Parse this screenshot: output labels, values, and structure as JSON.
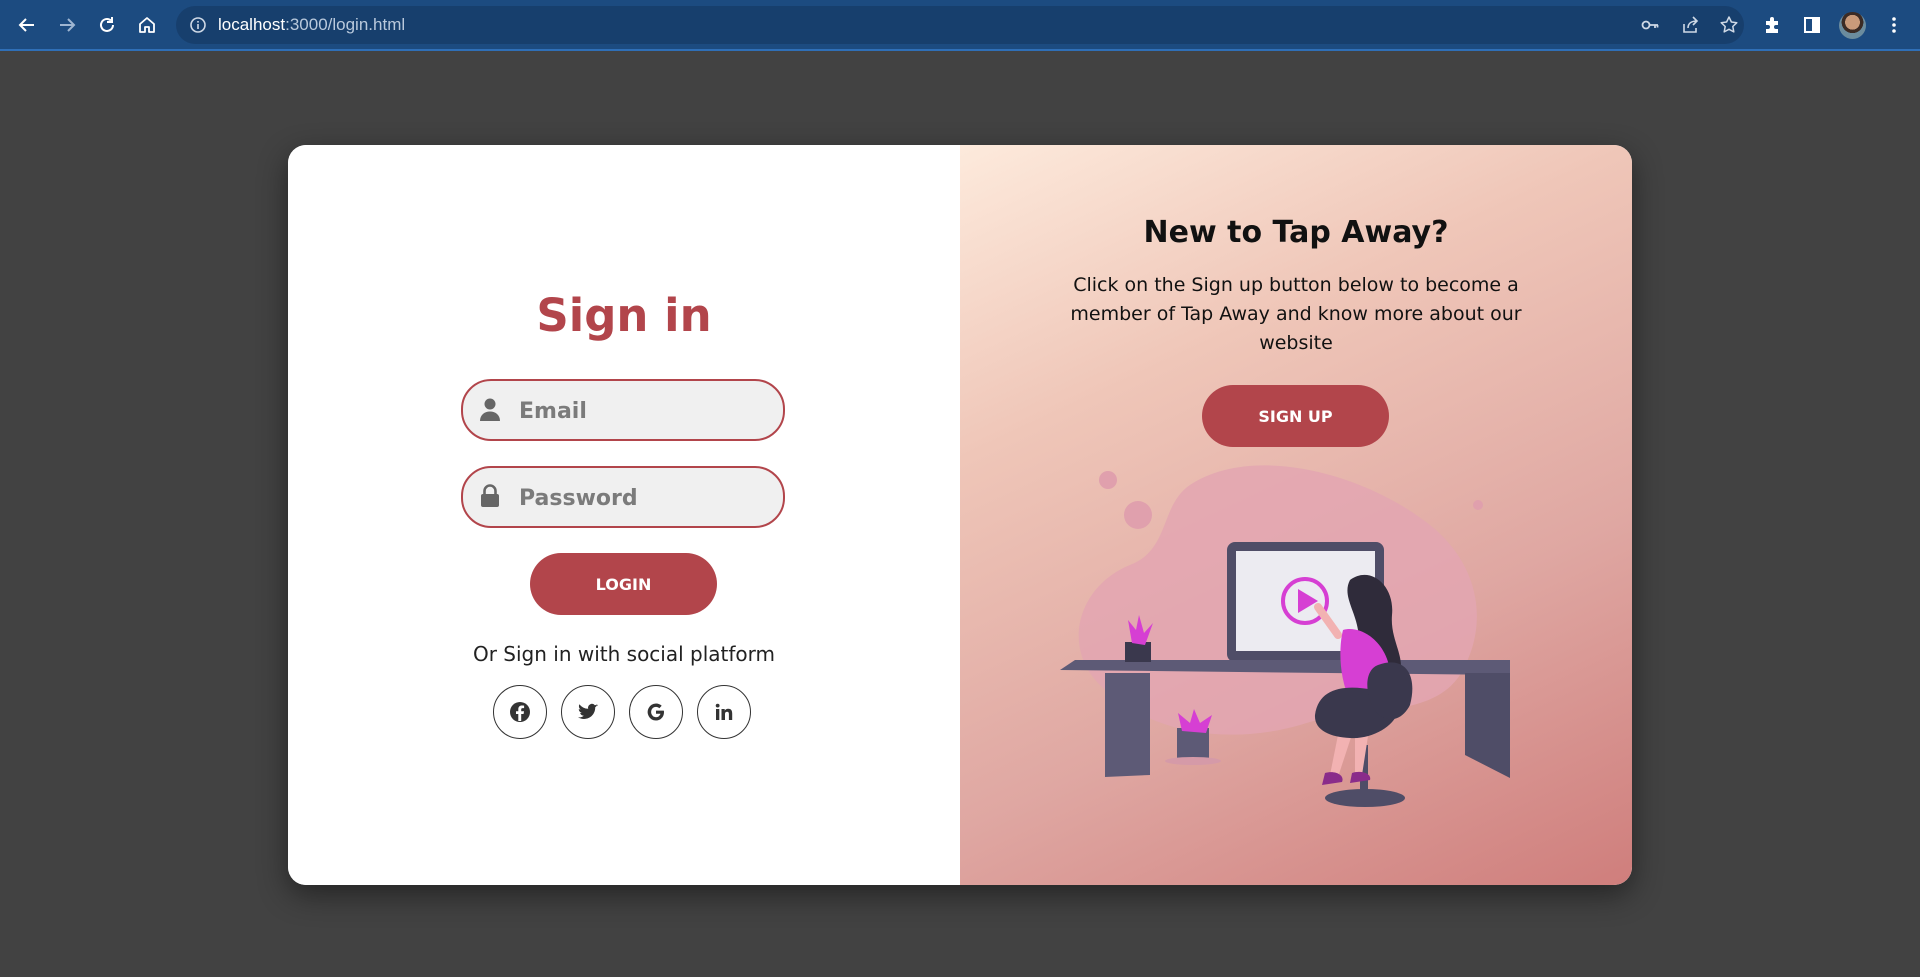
{
  "browser": {
    "url_host": "localhost",
    "url_path": ":3000/login.html"
  },
  "signin": {
    "title": "Sign in",
    "email_placeholder": "Email",
    "password_placeholder": "Password",
    "login_label": "LOGIN",
    "social_text": "Or Sign in with social platform",
    "social_icons": [
      "facebook-icon",
      "twitter-icon",
      "google-icon",
      "linkedin-icon"
    ]
  },
  "signup": {
    "title": "New to Tap Away?",
    "description": "Click on the Sign up button below to become a member of Tap Away and know more about our website",
    "button_label": "SIGN UP"
  },
  "colors": {
    "accent": "#b2454b",
    "browser_bar": "#1c4b80",
    "page_bg": "#424242"
  }
}
